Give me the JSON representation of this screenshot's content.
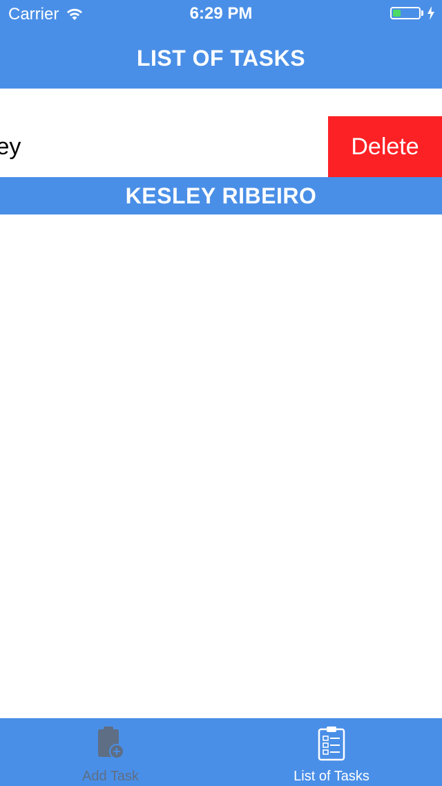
{
  "status_bar": {
    "carrier": "Carrier",
    "time": "6:29 PM",
    "battery_level": 0.3,
    "battery_color": "#4cd964"
  },
  "nav": {
    "title": "LIST OF TASKS"
  },
  "task_row": {
    "text": "Task Kesley",
    "delete_label": "Delete"
  },
  "section": {
    "footer_title": "KESLEY RIBEIRO"
  },
  "tab_bar": {
    "tabs": [
      {
        "label": "Add Task",
        "icon": "clipboard-add-icon",
        "selected": false
      },
      {
        "label": "List of Tasks",
        "icon": "clipboard-checklist-icon",
        "selected": true
      }
    ]
  },
  "colors": {
    "brand_blue": "#4a8fe7",
    "delete_red": "#fc2125",
    "inactive_tab": "#5e6e85"
  }
}
